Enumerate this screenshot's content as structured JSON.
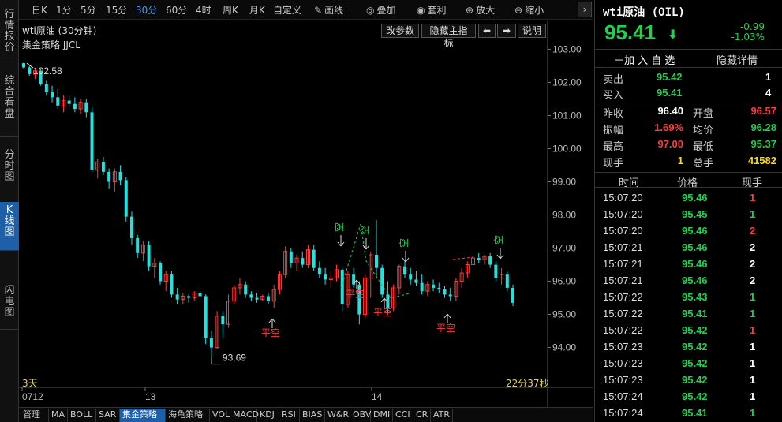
{
  "sidebar": {
    "tabs": [
      {
        "label": "行情报价"
      },
      {
        "label": "综合看盘"
      },
      {
        "label": "分时图"
      },
      {
        "label": "K线图"
      },
      {
        "label": "闪电图"
      }
    ]
  },
  "toolbar": {
    "periods": [
      "日K",
      "1分",
      "5分",
      "15分",
      "30分",
      "60分",
      "4时",
      "周K",
      "月K",
      "自定义"
    ],
    "active_period": "30分",
    "tools": [
      {
        "icon": "pencil-icon",
        "label": "画线"
      },
      {
        "icon": "layers-icon",
        "label": "叠加"
      },
      {
        "icon": "money-bag-icon",
        "label": "套利"
      },
      {
        "icon": "zoom-in-icon",
        "label": "放大"
      },
      {
        "icon": "zoom-out-icon",
        "label": "缩小"
      }
    ],
    "more": "›"
  },
  "chart": {
    "title": "wti原油 (30分钟)",
    "strategy": "集金策略 JJCL",
    "buttons": {
      "params": "改参数",
      "hide_main": "隐藏主指标",
      "left": "⬅",
      "right": "➡",
      "help": "说明"
    },
    "days": "3天",
    "countdown": "22分37秒",
    "high_label": "102.58",
    "low_label": "93.69",
    "signals": [
      {
        "text": "平空",
        "color": "#ff3b3b"
      },
      {
        "text": "空",
        "color": "#1fd14b"
      },
      {
        "text": "空",
        "color": "#1fd14b"
      },
      {
        "text": "平空",
        "color": "#ff3b3b"
      },
      {
        "text": "平空",
        "color": "#ff3b3b"
      },
      {
        "text": "空",
        "color": "#1fd14b"
      },
      {
        "text": "平空",
        "color": "#ff3b3b"
      },
      {
        "text": "空",
        "color": "#1fd14b"
      }
    ]
  },
  "chart_data": {
    "type": "candlestick",
    "y_ticks": [
      "103.00",
      "102.00",
      "101.00",
      "100.00",
      "99.00",
      "98.00",
      "97.00",
      "96.00",
      "95.00",
      "94.00"
    ],
    "x_ticks": [
      "0712",
      "13",
      "14"
    ],
    "ylim": [
      93.3,
      103.2
    ],
    "up_color": "#ff3b3b",
    "down_color": "#26e0e0",
    "candles": [
      [
        102.58,
        102.6,
        102.4,
        102.45
      ],
      [
        102.45,
        102.5,
        102.2,
        102.25
      ],
      [
        102.25,
        102.4,
        102.1,
        102.35
      ],
      [
        102.35,
        102.4,
        101.9,
        101.95
      ],
      [
        101.95,
        102.05,
        101.6,
        101.7
      ],
      [
        101.7,
        101.9,
        101.4,
        101.55
      ],
      [
        101.55,
        101.8,
        101.2,
        101.3
      ],
      [
        101.3,
        101.6,
        101.1,
        101.45
      ],
      [
        101.45,
        101.6,
        101.25,
        101.35
      ],
      [
        101.35,
        101.55,
        101.1,
        101.2
      ],
      [
        101.2,
        101.5,
        101.05,
        101.4
      ],
      [
        101.4,
        101.5,
        100.95,
        101.1
      ],
      [
        101.1,
        101.25,
        99.3,
        99.35
      ],
      [
        99.35,
        99.7,
        99.1,
        99.6
      ],
      [
        99.6,
        99.75,
        99.2,
        99.3
      ],
      [
        99.3,
        99.4,
        98.8,
        99.0
      ],
      [
        99.0,
        99.4,
        98.7,
        99.3
      ],
      [
        99.3,
        99.5,
        98.9,
        99.05
      ],
      [
        99.05,
        99.15,
        97.8,
        97.95
      ],
      [
        97.95,
        98.1,
        97.1,
        97.3
      ],
      [
        97.3,
        97.4,
        96.7,
        96.85
      ],
      [
        96.85,
        97.2,
        96.6,
        97.1
      ],
      [
        97.1,
        97.2,
        96.3,
        96.45
      ],
      [
        96.45,
        96.7,
        96.1,
        96.55
      ],
      [
        96.55,
        96.6,
        95.9,
        96.0
      ],
      [
        96.0,
        96.3,
        95.7,
        96.2
      ],
      [
        96.2,
        96.3,
        95.5,
        95.6
      ],
      [
        95.6,
        95.8,
        95.3,
        95.45
      ],
      [
        95.45,
        95.65,
        95.3,
        95.55
      ],
      [
        95.55,
        95.6,
        95.35,
        95.5
      ],
      [
        95.5,
        95.7,
        95.4,
        95.65
      ],
      [
        95.65,
        95.8,
        95.45,
        95.55
      ],
      [
        95.55,
        95.6,
        94.1,
        94.3
      ],
      [
        94.3,
        94.5,
        93.69,
        94.0
      ],
      [
        94.0,
        95.1,
        93.95,
        94.95
      ],
      [
        94.95,
        95.1,
        94.3,
        94.7
      ],
      [
        94.7,
        95.6,
        94.6,
        95.4
      ],
      [
        95.4,
        95.9,
        95.3,
        95.8
      ],
      [
        95.8,
        96.1,
        95.6,
        95.9
      ],
      [
        95.9,
        96.0,
        95.5,
        95.6
      ],
      [
        95.6,
        95.7,
        95.4,
        95.5
      ],
      [
        95.5,
        95.65,
        95.35,
        95.45
      ],
      [
        95.45,
        95.6,
        95.4,
        95.55
      ],
      [
        95.55,
        95.65,
        95.3,
        95.4
      ],
      [
        95.4,
        95.9,
        95.2,
        95.75
      ],
      [
        95.75,
        96.3,
        95.6,
        96.2
      ],
      [
        96.2,
        97.05,
        96.1,
        96.9
      ],
      [
        96.9,
        97.0,
        96.4,
        96.55
      ],
      [
        96.55,
        96.8,
        96.3,
        96.7
      ],
      [
        96.7,
        96.9,
        96.4,
        96.5
      ],
      [
        96.5,
        97.1,
        96.4,
        96.95
      ],
      [
        96.95,
        97.1,
        96.3,
        96.4
      ],
      [
        96.4,
        96.6,
        96.1,
        96.2
      ],
      [
        96.2,
        96.4,
        95.9,
        96.05
      ],
      [
        96.05,
        96.3,
        95.8,
        96.1
      ],
      [
        96.1,
        96.5,
        96.0,
        96.35
      ],
      [
        96.35,
        96.4,
        95.1,
        95.3
      ],
      [
        95.3,
        96.3,
        95.2,
        96.2
      ],
      [
        96.2,
        96.4,
        95.8,
        95.9
      ],
      [
        95.9,
        96.0,
        94.7,
        95.0
      ],
      [
        95.0,
        96.2,
        94.9,
        96.1
      ],
      [
        96.1,
        96.9,
        95.5,
        96.8
      ],
      [
        96.8,
        97.85,
        96.1,
        96.4
      ],
      [
        96.4,
        96.5,
        95.5,
        95.6
      ],
      [
        95.6,
        96.0,
        95.0,
        95.2
      ],
      [
        95.2,
        95.9,
        95.1,
        95.8
      ],
      [
        95.8,
        96.5,
        95.6,
        96.45
      ],
      [
        96.45,
        96.6,
        96.1,
        96.2
      ],
      [
        96.2,
        96.4,
        95.9,
        96.05
      ],
      [
        96.05,
        96.3,
        95.85,
        95.95
      ],
      [
        95.95,
        96.2,
        95.6,
        95.7
      ],
      [
        95.7,
        96.0,
        95.55,
        95.9
      ],
      [
        95.9,
        96.05,
        95.7,
        95.8
      ],
      [
        95.8,
        95.95,
        95.65,
        95.75
      ],
      [
        95.75,
        95.85,
        95.5,
        95.6
      ],
      [
        95.6,
        95.8,
        95.4,
        95.55
      ],
      [
        95.55,
        96.1,
        95.4,
        96.0
      ],
      [
        96.0,
        96.4,
        95.8,
        96.25
      ],
      [
        96.25,
        96.6,
        96.1,
        96.5
      ],
      [
        96.5,
        96.8,
        96.4,
        96.7
      ],
      [
        96.7,
        96.85,
        96.55,
        96.65
      ],
      [
        96.65,
        96.8,
        96.5,
        96.75
      ],
      [
        96.75,
        96.85,
        96.4,
        96.5
      ],
      [
        96.5,
        96.6,
        96.0,
        96.1
      ],
      [
        96.1,
        96.4,
        95.9,
        96.2
      ],
      [
        96.2,
        96.3,
        95.7,
        95.8
      ],
      [
        95.8,
        95.9,
        95.25,
        95.35
      ]
    ]
  },
  "indicators": {
    "items": [
      "管理",
      "MA",
      "BOLL",
      "SAR",
      "集金策略",
      "海龟策略",
      "VOL",
      "MACD",
      "KDJ",
      "RSI",
      "BIAS",
      "W&R",
      "OBV",
      "DMI",
      "CCI",
      "CR",
      "ATR"
    ],
    "active": "集金策略"
  },
  "quote": {
    "title": "wti原油 (OIL)",
    "price": "95.41",
    "arrow": "⬇",
    "change": "-0.99",
    "change_pct": "-1.03%",
    "add_label": "＋加 入 自 选",
    "hide_label": "隐藏详情",
    "sell": {
      "label": "卖出",
      "price": "95.42",
      "qty": "1"
    },
    "buy": {
      "label": "买入",
      "price": "95.41",
      "qty": "4"
    },
    "stats": [
      {
        "l1": "昨收",
        "v1": "96.40",
        "c1": "#ffffff",
        "l2": "开盘",
        "v2": "96.57",
        "c2": "#ff3b3b"
      },
      {
        "l1": "振幅",
        "v1": "1.69%",
        "c1": "#ff3b3b",
        "l2": "均价",
        "v2": "96.28",
        "c2": "#1fd14b"
      },
      {
        "l1": "最高",
        "v1": "97.00",
        "c1": "#ff3b3b",
        "l2": "最低",
        "v2": "95.37",
        "c2": "#1fd14b"
      },
      {
        "l1": "现手",
        "v1": "1",
        "c1": "#ffdd00",
        "l2": "总手",
        "v2": "41582",
        "c2": "#ffdd00"
      }
    ],
    "tick_headers": {
      "time": "时间",
      "price": "价格",
      "qty": "现手"
    },
    "ticks": [
      {
        "time": "15:07:20",
        "price": "95.46",
        "qty": "1",
        "color": "#ff3b3b"
      },
      {
        "time": "15:07:20",
        "price": "95.45",
        "qty": "1",
        "color": "#1fd14b"
      },
      {
        "time": "15:07:20",
        "price": "95.46",
        "qty": "2",
        "color": "#ff3b3b"
      },
      {
        "time": "15:07:21",
        "price": "95.46",
        "qty": "2",
        "color": "#ffffff"
      },
      {
        "time": "15:07:21",
        "price": "95.46",
        "qty": "2",
        "color": "#ffffff"
      },
      {
        "time": "15:07:21",
        "price": "95.46",
        "qty": "2",
        "color": "#ffffff"
      },
      {
        "time": "15:07:22",
        "price": "95.43",
        "qty": "1",
        "color": "#1fd14b"
      },
      {
        "time": "15:07:22",
        "price": "95.41",
        "qty": "1",
        "color": "#1fd14b"
      },
      {
        "time": "15:07:22",
        "price": "95.42",
        "qty": "1",
        "color": "#ff3b3b"
      },
      {
        "time": "15:07:23",
        "price": "95.42",
        "qty": "1",
        "color": "#ffffff"
      },
      {
        "time": "15:07:23",
        "price": "95.42",
        "qty": "1",
        "color": "#ffffff"
      },
      {
        "time": "15:07:23",
        "price": "95.42",
        "qty": "1",
        "color": "#ffffff"
      },
      {
        "time": "15:07:24",
        "price": "95.42",
        "qty": "1",
        "color": "#ffffff"
      },
      {
        "time": "15:07:24",
        "price": "95.41",
        "qty": "1",
        "color": "#1fd14b"
      }
    ]
  }
}
